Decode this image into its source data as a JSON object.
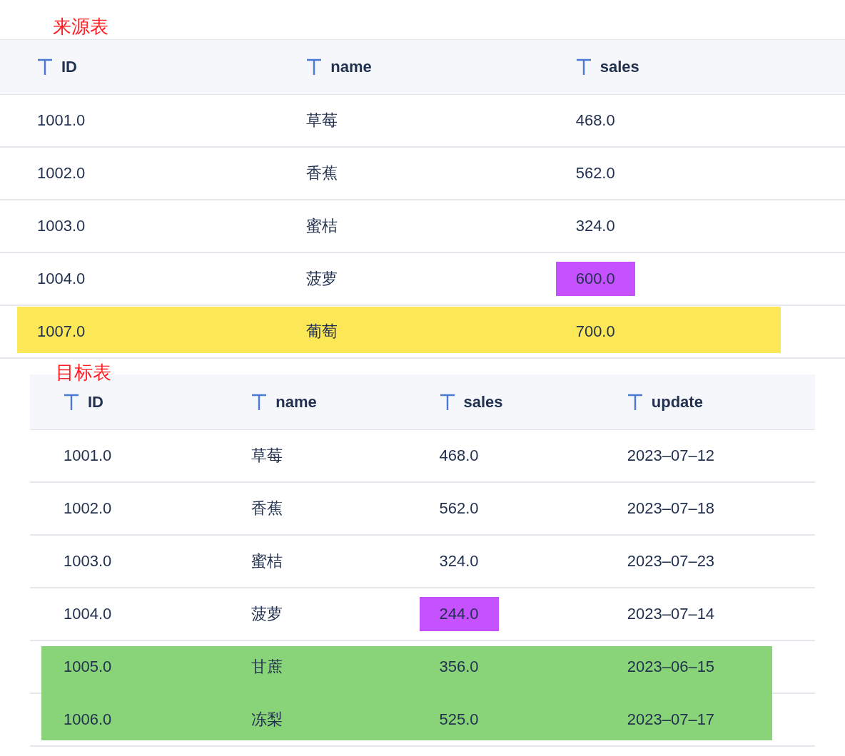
{
  "tables": [
    {
      "title": "来源表",
      "columns": [
        "ID",
        "name",
        "sales"
      ],
      "rows": [
        {
          "cells": [
            {
              "text": "1001.0"
            },
            {
              "text": "草莓"
            },
            {
              "text": "468.0"
            }
          ]
        },
        {
          "cells": [
            {
              "text": "1002.0"
            },
            {
              "text": "香蕉"
            },
            {
              "text": "562.0"
            }
          ]
        },
        {
          "cells": [
            {
              "text": "1003.0"
            },
            {
              "text": "蜜桔"
            },
            {
              "text": "324.0"
            }
          ]
        },
        {
          "cells": [
            {
              "text": "1004.0"
            },
            {
              "text": "菠萝"
            },
            {
              "text": "600.0",
              "color": "#c552fe"
            }
          ]
        },
        {
          "color": "#fce757",
          "cells": [
            {
              "text": "1007.0"
            },
            {
              "text": "葡萄"
            },
            {
              "text": "700.0"
            }
          ]
        }
      ]
    },
    {
      "title": "目标表",
      "columns": [
        "ID",
        "name",
        "sales",
        "update"
      ],
      "rows": [
        {
          "cells": [
            {
              "text": "1001.0"
            },
            {
              "text": "草莓"
            },
            {
              "text": "468.0"
            },
            {
              "text": "2023–07–12"
            }
          ]
        },
        {
          "cells": [
            {
              "text": "1002.0"
            },
            {
              "text": "香蕉"
            },
            {
              "text": "562.0"
            },
            {
              "text": "2023–07–18"
            }
          ]
        },
        {
          "cells": [
            {
              "text": "1003.0"
            },
            {
              "text": "蜜桔"
            },
            {
              "text": "324.0"
            },
            {
              "text": "2023–07–23"
            }
          ]
        },
        {
          "cells": [
            {
              "text": "1004.0"
            },
            {
              "text": "菠萝"
            },
            {
              "text": "244.0",
              "color": "#c552fe"
            },
            {
              "text": "2023–07–14"
            }
          ]
        },
        {
          "color": "#89d378",
          "cells": [
            {
              "text": "1005.0"
            },
            {
              "text": "甘蔗"
            },
            {
              "text": "356.0"
            },
            {
              "text": "2023–06–15"
            }
          ]
        },
        {
          "color": "#89d378",
          "cells": [
            {
              "text": "1006.0"
            },
            {
              "text": "冻梨"
            },
            {
              "text": "525.0"
            },
            {
              "text": "2023–07–17"
            }
          ]
        }
      ]
    }
  ]
}
